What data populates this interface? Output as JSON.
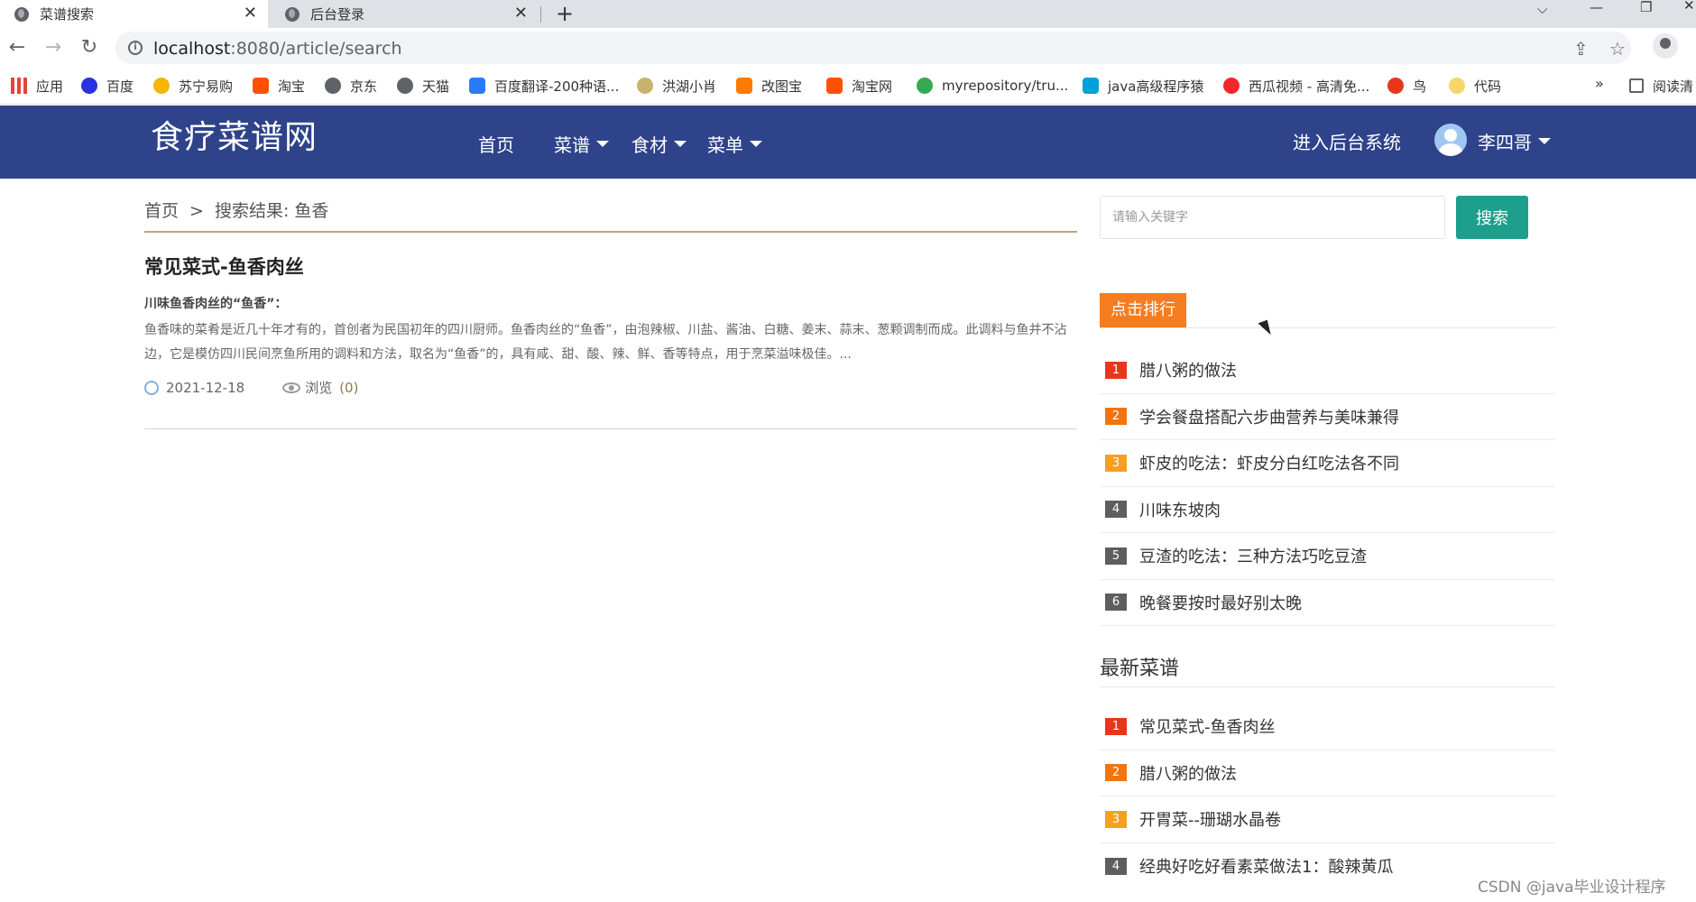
{
  "browser": {
    "tabs": [
      {
        "label": "菜谱搜索"
      },
      {
        "label": "后台登录"
      }
    ],
    "new_tab": "+",
    "url_host": "localhost",
    "url_path": ":8080/article/search",
    "bookmarks": [
      "应用",
      "百度",
      "苏宁易购",
      "淘宝",
      "京东",
      "天猫",
      "百度翻译-200种语...",
      "洪湖小肖",
      "改图宝",
      "淘宝网",
      "myrepository/tru...",
      "java高级程序猿",
      "西瓜视频 - 高清免...",
      "鸟",
      "代码"
    ],
    "bookmarks_more": "»",
    "reading_list": "阅读清"
  },
  "site": {
    "logo": "食疗菜谱网",
    "nav": [
      "首页",
      "菜谱",
      "食材",
      "菜单"
    ],
    "admin_link": "进入后台系统",
    "user_name": "李四哥"
  },
  "breadcrumb": {
    "home": "首页",
    "sep": ">",
    "current": "搜索结果: 鱼香"
  },
  "article": {
    "title": "常见菜式-鱼香肉丝",
    "subtitle": "川味鱼香肉丝的“鱼香”：",
    "body": "鱼香味的菜肴是近几十年才有的，首创者为民国初年的四川厨师。鱼香肉丝的“鱼香”，由泡辣椒、川盐、酱油、白糖、姜末、蒜末、葱颗调制而成。此调料与鱼并不沾边，它是模仿四川民间烹鱼所用的调料和方法，取名为“鱼香”的，具有咸、甜、酸、辣、鲜、香等特点，用于烹菜溢味极佳。...",
    "date": "2021-12-18",
    "views_label": "浏览",
    "views": "(0)"
  },
  "sidebar": {
    "search_placeholder": "请输入关键字",
    "search_button": "搜索",
    "rank_title": "点击排行",
    "rank_items": [
      {
        "num": "1",
        "text": "腊八粥的做法",
        "color": "#e8361d"
      },
      {
        "num": "2",
        "text": "学会餐盘搭配六步曲营养与美味兼得",
        "color": "#f2740f"
      },
      {
        "num": "3",
        "text": "虾皮的吃法：虾皮分白红吃法各不同",
        "color": "#f5a021"
      },
      {
        "num": "4",
        "text": "川味东坡肉",
        "color": "#5e5e5e"
      },
      {
        "num": "5",
        "text": "豆渣的吃法：三种方法巧吃豆渣",
        "color": "#5e5e5e"
      },
      {
        "num": "6",
        "text": "晚餐要按时最好别太晚",
        "color": "#5e5e5e"
      }
    ],
    "latest_title": "最新菜谱",
    "latest_items": [
      {
        "num": "1",
        "text": "常见菜式-鱼香肉丝",
        "color": "#e8361d"
      },
      {
        "num": "2",
        "text": "腊八粥的做法",
        "color": "#f2740f"
      },
      {
        "num": "3",
        "text": "开胃菜--珊瑚水晶卷",
        "color": "#f5a021"
      },
      {
        "num": "4",
        "text": "经典好吃好看素菜做法1：酸辣黄瓜",
        "color": "#5e5e5e"
      }
    ]
  },
  "watermark": "CSDN @java毕业设计程序",
  "colors": {
    "header_bg": "#2e4389",
    "search_btn": "#1e9e8c",
    "rank_head": "#f57c1f"
  }
}
